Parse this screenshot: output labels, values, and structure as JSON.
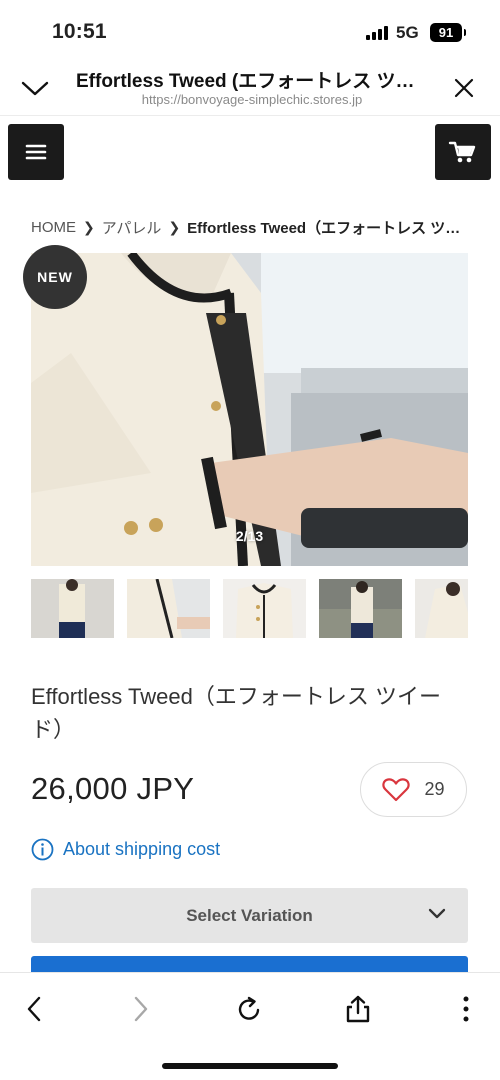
{
  "status_bar": {
    "time": "10:51",
    "network": "5G",
    "battery": "91"
  },
  "browser": {
    "title": "Effortless Tweed (エフォートレス ツ…",
    "url": "https://bonvoyage-simplechic.stores.jp"
  },
  "site_nav": {
    "menu_icon": "hamburger-icon",
    "cart_icon": "cart-icon"
  },
  "breadcrumb": [
    {
      "label": "HOME"
    },
    {
      "label": "アパレル"
    },
    {
      "label": "Effortless Tweed（エフォートレス ツイ…"
    }
  ],
  "gallery": {
    "badge": "NEW",
    "counter": "2/13",
    "thumbnail_count": 5
  },
  "product": {
    "name": "Effortless Tweed（エフォートレス ツイード）",
    "price": "26,000 JPY",
    "favorite_count": "29",
    "shipping_link": "About shipping cost",
    "variation_placeholder": "Select Variation"
  },
  "colors": {
    "accent_blue": "#1a6fd1",
    "link_blue": "#1a73c2",
    "heart_red": "#d9363e",
    "dark": "#1b1b1b"
  }
}
